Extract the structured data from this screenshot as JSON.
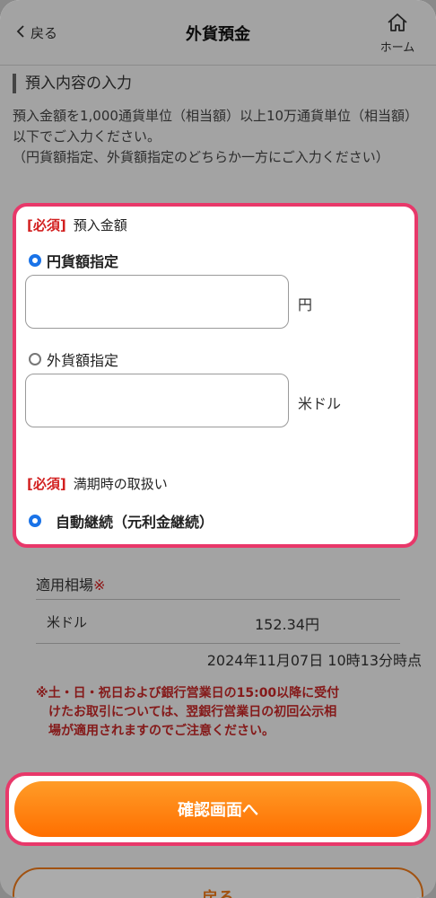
{
  "header": {
    "back_label": "戻る",
    "title": "外貨預金",
    "home_label": "ホーム"
  },
  "section": {
    "title": "預入内容の入力",
    "description": "預入金額を1,000通貨単位（相当額）以上10万通貨単位（相当額）以下でご入力ください。\n（円貨額指定、外貨額指定のどちらか一方にご入力ください）"
  },
  "form": {
    "required_tag": "[必須]",
    "amount_label": "預入金額",
    "yen_option": "円貨額指定",
    "yen_value": "",
    "yen_unit": "円",
    "fx_option": "外貨額指定",
    "fx_value": "",
    "fx_unit": "米ドル",
    "maturity_label": "満期時の取扱い",
    "maturity_option": "自動継続（元利金継続）"
  },
  "rate": {
    "title": "適用相場",
    "mark": "※",
    "currency": "米ドル",
    "value": "152.34円",
    "timestamp": "2024年11月07日 10時13分時点",
    "note": "※土・日・祝日および銀行営業日の15:00以降に受付\n　けたお取引については、翌銀行営業日の初回公示相\n　場が適用されますのでご注意ください。"
  },
  "buttons": {
    "confirm": "確認画面へ",
    "back": "戻る"
  },
  "colors": {
    "highlight": "#e8386a",
    "accent_orange": "#ff8a00",
    "radio_blue": "#1a73e8",
    "required_red": "#d21f1f"
  },
  "icons": {
    "back": "chevron-left-icon",
    "home": "home-icon"
  }
}
